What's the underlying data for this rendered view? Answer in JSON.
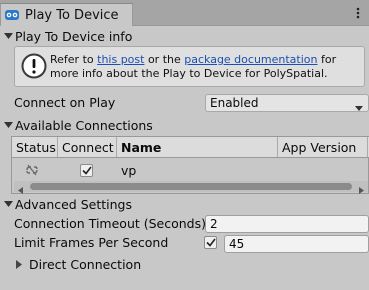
{
  "window": {
    "tab_title": "Play To Device",
    "menu_icon": "kebab-menu-icon",
    "tab_icon": "unity-vr-headset-icon"
  },
  "info_section": {
    "title": "Play To Device info",
    "help_icon": "exclamation-circle-icon",
    "text_before_link1": "Refer to ",
    "link1": "this post",
    "text_between": " or the ",
    "link2": "package documentation",
    "text_after": " for more info about the Play to Device for PolySpatial."
  },
  "connect_on_play": {
    "label": "Connect on Play",
    "value": "Enabled"
  },
  "connections": {
    "title": "Available Connections",
    "columns": [
      "Status",
      "Connect",
      "Name",
      "App Version"
    ],
    "rows": [
      {
        "status_icon": "disconnected-link-icon",
        "connect": true,
        "name": "vp",
        "app_version": ""
      }
    ]
  },
  "advanced": {
    "title": "Advanced Settings",
    "timeout_label": "Connection Timeout (Seconds)",
    "timeout_value": "2",
    "limit_fps_label": "Limit Frames Per Second",
    "limit_fps_enabled": true,
    "fps_value": "45",
    "direct_connection_label": "Direct Connection"
  },
  "colors": {
    "background": "#c8c8c8",
    "link": "#1b4fb3"
  }
}
